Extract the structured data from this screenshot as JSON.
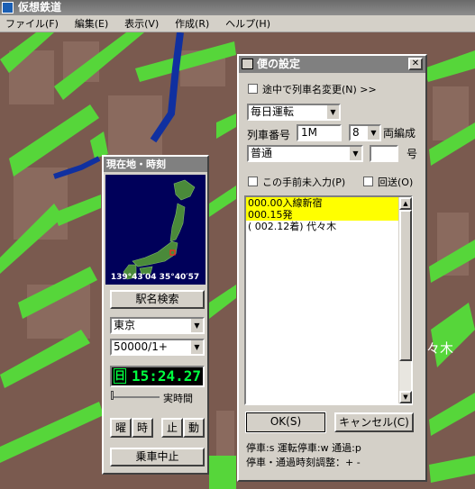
{
  "app": {
    "title": "仮想鉄道",
    "menu": [
      "ファイル(F)",
      "編集(E)",
      "表示(V)",
      "作成(R)",
      "ヘルプ(H)"
    ]
  },
  "map": {
    "station_label": "代々木"
  },
  "location_panel": {
    "title": "現在地・時刻",
    "coords": "139°43′04  35°40′57",
    "search_button": "駅名検索",
    "area": "東京",
    "scale": "50000/1+",
    "day_indicator": "日",
    "clock": "15:24.27",
    "realtime_label": "実時間",
    "buttons": [
      "曜",
      "時",
      "止",
      "動"
    ],
    "stop_riding": "乗車中止"
  },
  "dialog": {
    "title": "便の設定",
    "rename_checkbox": "途中で列車名変更(N) >>",
    "operation_day": "毎日運転",
    "train_number_label": "列車番号",
    "train_number": "1M",
    "cars": "8",
    "cars_unit": "両編成",
    "train_type": "普通",
    "train_type_no": "",
    "train_type_no_label": "号",
    "unentered_checkbox": "この手前未入力(P)",
    "deadhead_checkbox": "回送(O)",
    "stops": [
      {
        "text": "000.00入線新宿",
        "selected": true
      },
      {
        "text": "000.15発",
        "selected": true
      },
      {
        "text": "( 002.12着) 代々木",
        "selected": false
      }
    ],
    "ok_button": "OK(S)",
    "cancel_button": "キャンセル(C)",
    "legend_line1": "停車:s  運転停車:w 通過:p",
    "legend_line2": "停車・通過時刻調整：+ -"
  },
  "colors": {
    "map_ground": "#7a5a4f",
    "park_green": "#56d63a",
    "river_blue": "#1030a0",
    "clock_green": "#00ff40",
    "selected_row": "#ffff00"
  }
}
